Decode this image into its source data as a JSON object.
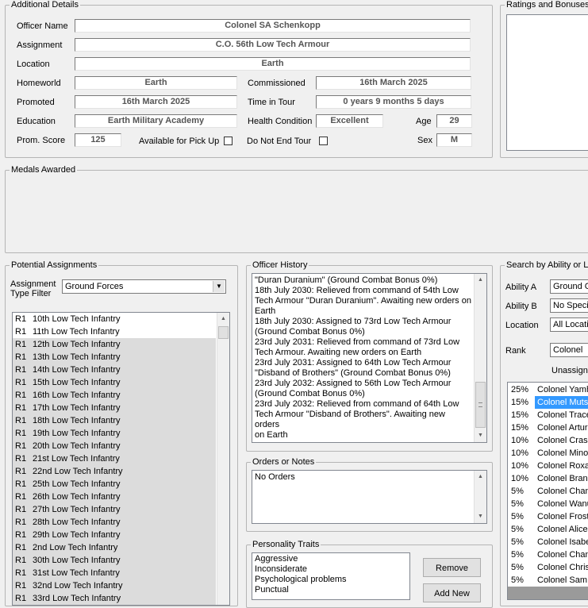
{
  "details": {
    "title": "Additional Details",
    "officer_name_label": "Officer Name",
    "officer_name": "Colonel SA Schenkopp",
    "assignment_label": "Assignment",
    "assignment": "C.O. 56th Low Tech Armour",
    "location_label": "Location",
    "location": "Earth",
    "homeworld_label": "Homeworld",
    "homeworld": "Earth",
    "commissioned_label": "Commissioned",
    "commissioned": "16th March 2025",
    "promoted_label": "Promoted",
    "promoted": "16th March 2025",
    "time_in_tour_label": "Time in Tour",
    "time_in_tour": "0 years 9 months 5 days",
    "education_label": "Education",
    "education": "Earth Military Academy",
    "health_label": "Health Condition",
    "health": "Excellent",
    "age_label": "Age",
    "age": "29",
    "prom_score_label": "Prom. Score",
    "prom_score": "125",
    "pickup_label": "Available for Pick Up",
    "not_end_tour_label": "Do Not End Tour",
    "sex_label": "Sex",
    "sex": "M"
  },
  "ratings": {
    "title": "Ratings and Bonuses"
  },
  "medals": {
    "title": "Medals Awarded"
  },
  "potential": {
    "title": "Potential Assignments",
    "filter_label_1": "Assignment",
    "filter_label_2": "Type Filter",
    "filter_value": "Ground Forces",
    "items": [
      {
        "code": "R1",
        "name": "10th Low Tech Infantry"
      },
      {
        "code": "R1",
        "name": "11th Low Tech Infantry"
      },
      {
        "code": "R1",
        "name": "12th Low Tech Infantry"
      },
      {
        "code": "R1",
        "name": "13th Low Tech Infantry"
      },
      {
        "code": "R1",
        "name": "14th Low Tech Infantry"
      },
      {
        "code": "R1",
        "name": "15th Low Tech Infantry"
      },
      {
        "code": "R1",
        "name": "16th Low Tech Infantry"
      },
      {
        "code": "R1",
        "name": "17th Low Tech Infantry"
      },
      {
        "code": "R1",
        "name": "18th Low Tech Infantry"
      },
      {
        "code": "R1",
        "name": "19th Low Tech Infantry"
      },
      {
        "code": "R1",
        "name": "20th Low Tech Infantry"
      },
      {
        "code": "R1",
        "name": "21st Low Tech Infantry"
      },
      {
        "code": "R1",
        "name": "22nd Low Tech Infantry"
      },
      {
        "code": "R1",
        "name": "25th Low Tech Infantry"
      },
      {
        "code": "R1",
        "name": "26th Low Tech Infantry"
      },
      {
        "code": "R1",
        "name": "27th Low Tech Infantry"
      },
      {
        "code": "R1",
        "name": "28th Low Tech Infantry"
      },
      {
        "code": "R1",
        "name": "29th Low Tech Infantry"
      },
      {
        "code": "R1",
        "name": "2nd Low Tech Infantry"
      },
      {
        "code": "R1",
        "name": "30th Low Tech Infantry"
      },
      {
        "code": "R1",
        "name": "31st Low Tech Infantry"
      },
      {
        "code": "R1",
        "name": "32nd Low Tech Infantry"
      },
      {
        "code": "R1",
        "name": "33rd Low Tech Infantry"
      }
    ]
  },
  "history": {
    "title": "Officer History",
    "lines": [
      "\"Duran Duranium\" (Ground Combat Bonus 0%)",
      "18th July 2030: Relieved from command of 54th Low",
      "Tech Armour \"Duran Duranium\". Awaiting new orders on",
      "Earth",
      "18th July 2030: Assigned to 73rd Low Tech Armour",
      "(Ground Combat Bonus 0%)",
      "23rd July 2031: Relieved from command of 73rd Low",
      "Tech Armour. Awaiting new orders on Earth",
      "23rd July 2031: Assigned to 64th Low Tech Armour",
      "\"Disband of Brothers\" (Ground Combat Bonus 0%)",
      "23rd July 2032: Assigned to 56th Low Tech Armour",
      "(Ground Combat Bonus 0%)",
      "23rd July 2032: Relieved from command of 64th Low",
      "Tech Armour \"Disband of Brothers\". Awaiting new orders",
      "on Earth"
    ]
  },
  "orders": {
    "title": "Orders or Notes",
    "text": "No Orders"
  },
  "traits": {
    "title": "Personality Traits",
    "items": [
      "Aggressive",
      "Inconsiderate",
      "Psychological problems",
      "Punctual"
    ],
    "remove_label": "Remove",
    "add_label": "Add New"
  },
  "search": {
    "title": "Search by Ability or Lo",
    "ability_a_label": "Ability A",
    "ability_a_value": "Ground C",
    "ability_b_label": "Ability B",
    "ability_b_value": "No Speci",
    "location_label": "Location",
    "location_value": "All Locatio",
    "rank_label": "Rank",
    "rank_value": "Colonel",
    "unassigned_label": "Unassigne",
    "candidates": [
      {
        "pct": "25%",
        "name": "Colonel Yamh"
      },
      {
        "pct": "15%",
        "name": "Colonel Mutsu"
      },
      {
        "pct": "15%",
        "name": "Colonel Trace"
      },
      {
        "pct": "15%",
        "name": "Colonel Arturo"
      },
      {
        "pct": "10%",
        "name": "Colonel Crass"
      },
      {
        "pct": "10%",
        "name": "Colonel Minor"
      },
      {
        "pct": "10%",
        "name": "Colonel Roxar"
      },
      {
        "pct": "10%",
        "name": "Colonel Brand"
      },
      {
        "pct": "5%",
        "name": "Colonel Cham"
      },
      {
        "pct": "5%",
        "name": "Colonel Wanu"
      },
      {
        "pct": "5%",
        "name": "Colonel Froste"
      },
      {
        "pct": "5%",
        "name": "Colonel Alice"
      },
      {
        "pct": "5%",
        "name": "Colonel Isabe"
      },
      {
        "pct": "5%",
        "name": "Colonel Chang"
      },
      {
        "pct": "5%",
        "name": "Colonel Christ"
      },
      {
        "pct": "5%",
        "name": "Colonel Sam B"
      }
    ]
  }
}
